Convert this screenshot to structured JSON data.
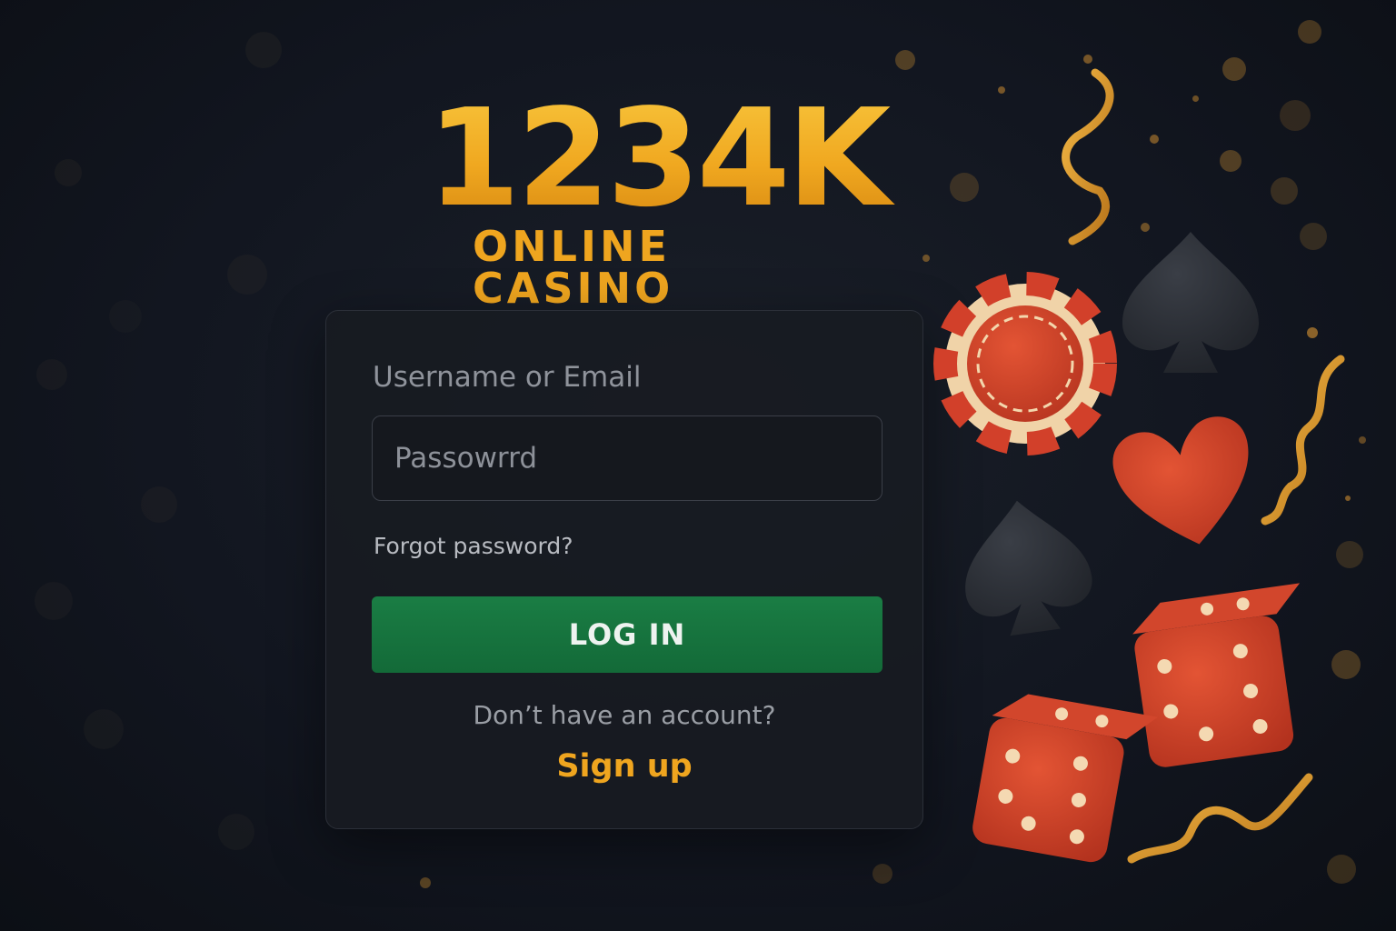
{
  "brand": {
    "logo_main": "1234K",
    "logo_sub": "ONLINE CASINO",
    "gold": "#efa51f"
  },
  "login": {
    "username_label": "Username or Email",
    "password_placeholder": "Passowrrd",
    "forgot_link": "Forgot password?",
    "login_button": "LOG IN",
    "no_account_text": "Don’t have an account?",
    "signup_link": "Sign up",
    "button_color": "#157240"
  },
  "decorations": {
    "icons": [
      "poker-chip-icon",
      "spade-icon",
      "heart-icon",
      "dice-icon",
      "ribbon-icon"
    ],
    "red": "#d2402a",
    "dark": "#262a31"
  }
}
